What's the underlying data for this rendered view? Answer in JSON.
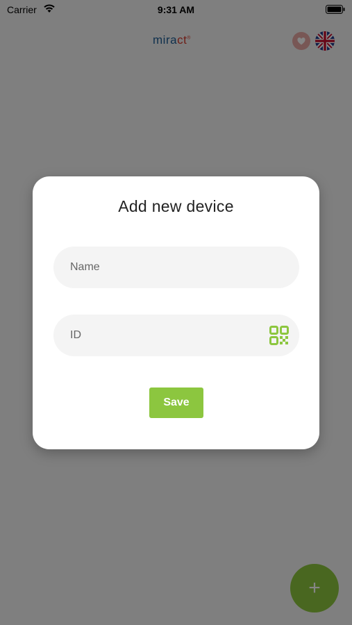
{
  "status_bar": {
    "carrier": "Carrier",
    "time": "9:31 AM"
  },
  "header": {
    "logo_part1": "mira",
    "logo_part2": "ct",
    "logo_mark": "®",
    "language_flag_icon": "uk-flag-icon",
    "badge_icon": "heart-icon"
  },
  "dialog": {
    "title": "Add new device",
    "name_placeholder": "Name",
    "id_placeholder": "ID",
    "scan_icon": "qr-code-icon",
    "save_label": "Save"
  },
  "fab": {
    "icon": "plus-icon",
    "label": "+"
  },
  "colors": {
    "accent_green": "#8cc63f",
    "logo_blue": "#1d5c95",
    "logo_red": "#d4392b",
    "field_bg": "#f4f4f4"
  }
}
